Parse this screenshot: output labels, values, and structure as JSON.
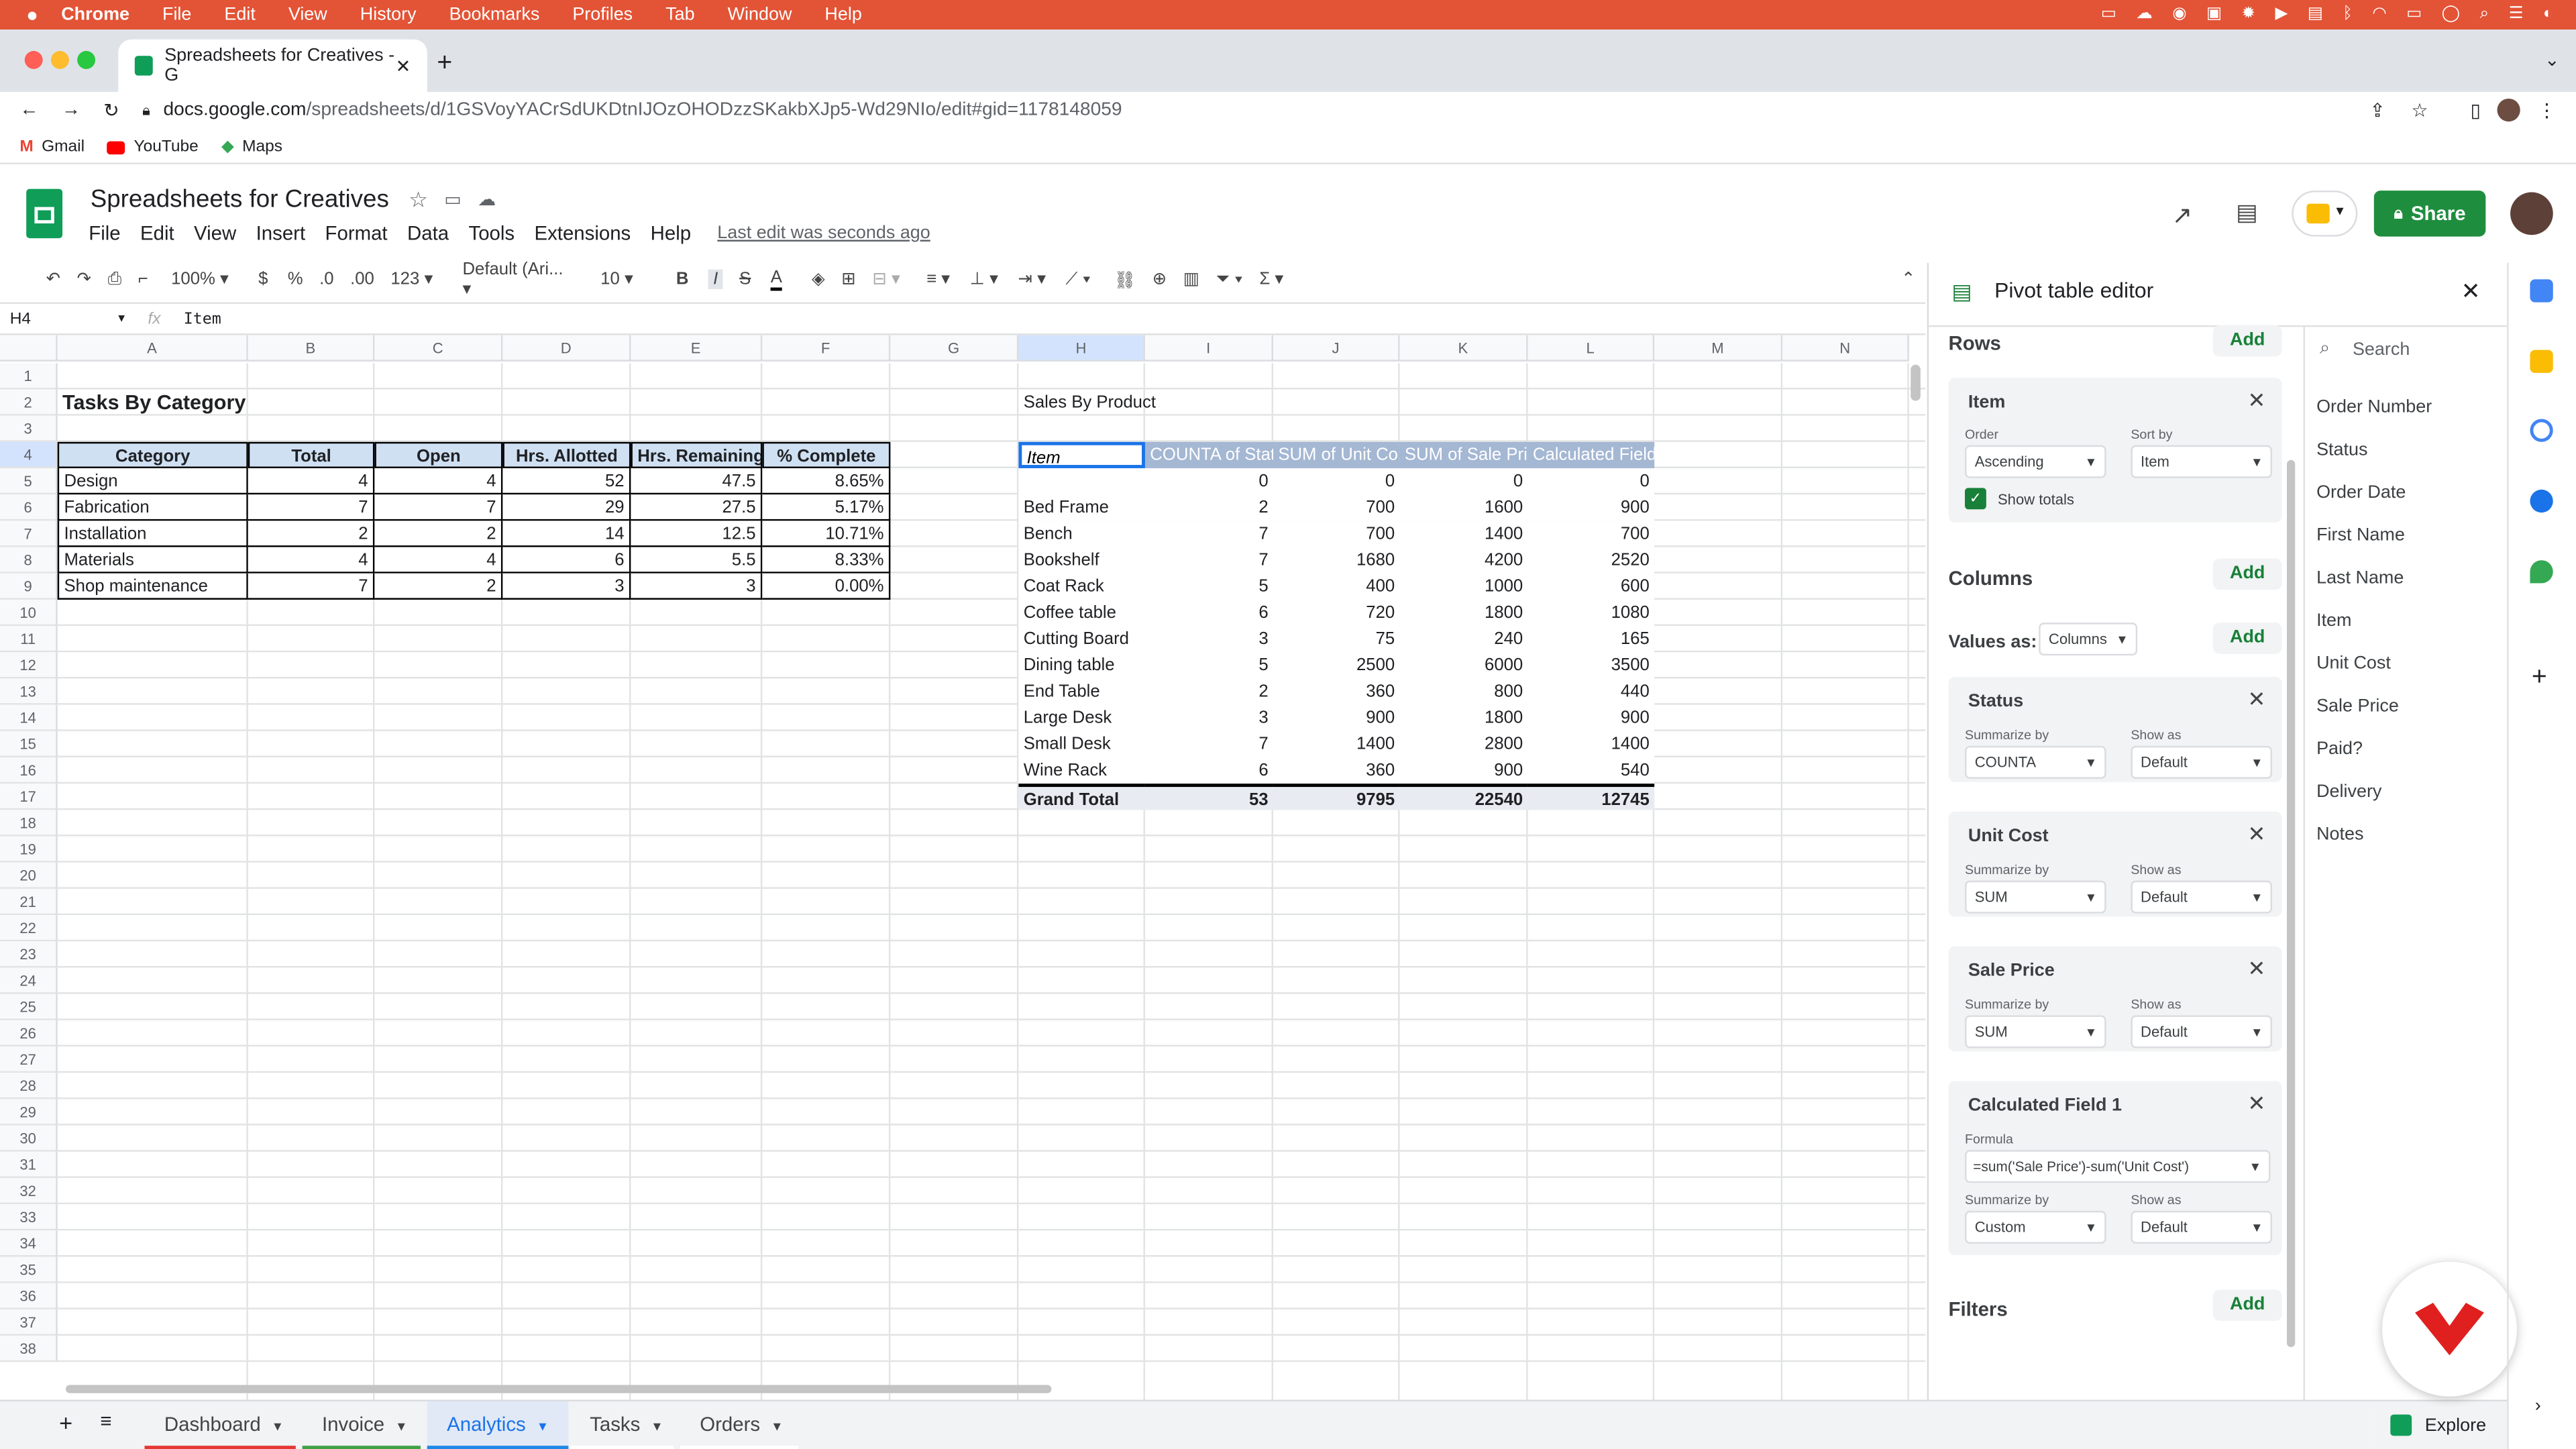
{
  "menubar": {
    "apple": "",
    "items": [
      "Chrome",
      "File",
      "Edit",
      "View",
      "History",
      "Bookmarks",
      "Profiles",
      "Tab",
      "Window",
      "Help"
    ]
  },
  "browser": {
    "tab_title": "Spreadsheets for Creatives - G",
    "url_host": "docs.google.com",
    "url_path": "/spreadsheets/d/1GSVoyYACrSdUKDtnIJOzOHODzzSKakbXJp5-Wd29NIo/edit#gid=1178148059",
    "bookmarks": [
      "Gmail",
      "YouTube",
      "Maps"
    ]
  },
  "doc": {
    "title": "Spreadsheets for Creatives",
    "menus": [
      "File",
      "Edit",
      "View",
      "Insert",
      "Format",
      "Data",
      "Tools",
      "Extensions",
      "Help"
    ],
    "last_edit": "Last edit was seconds ago",
    "share": "Share"
  },
  "toolbar": {
    "zoom": "100%",
    "currency": "$",
    "percent": "%",
    "dec_dec": ".0",
    "dec_inc": ".00",
    "numfmt": "123",
    "font": "Default (Ari...",
    "size": "10"
  },
  "formula_bar": {
    "cell_ref": "H4",
    "fx": "fx",
    "content": "Item"
  },
  "columns": [
    "A",
    "B",
    "C",
    "D",
    "E",
    "F",
    "G",
    "H",
    "I",
    "J",
    "K",
    "L",
    "M",
    "N"
  ],
  "rows": [
    "1",
    "2",
    "3",
    "4",
    "5",
    "6",
    "7",
    "8",
    "9",
    "10",
    "11",
    "12",
    "13",
    "14",
    "15",
    "16",
    "17",
    "18",
    "19",
    "20",
    "21",
    "22",
    "23",
    "24",
    "25",
    "26",
    "27",
    "28",
    "29",
    "30",
    "31",
    "32",
    "33",
    "34",
    "35",
    "36",
    "37",
    "38"
  ],
  "left_table": {
    "title": "Tasks By Category",
    "headers": [
      "Category",
      "Total",
      "Open",
      "Hrs. Allotted",
      "Hrs. Remaining",
      "% Complete"
    ],
    "rows": [
      [
        "Design",
        "4",
        "4",
        "52",
        "47.5",
        "8.65%"
      ],
      [
        "Fabrication",
        "7",
        "7",
        "29",
        "27.5",
        "5.17%"
      ],
      [
        "Installation",
        "2",
        "2",
        "14",
        "12.5",
        "10.71%"
      ],
      [
        "Materials",
        "4",
        "4",
        "6",
        "5.5",
        "8.33%"
      ],
      [
        "Shop maintenance",
        "7",
        "2",
        "3",
        "3",
        "0.00%"
      ]
    ]
  },
  "pivot": {
    "title": "Sales By Product",
    "headers": [
      "Item",
      "COUNTA of Stat",
      "SUM of Unit Co:",
      "SUM of Sale Pri",
      "Calculated Field"
    ],
    "rows": [
      [
        "",
        "0",
        "0",
        "0",
        "0"
      ],
      [
        "Bed Frame",
        "2",
        "700",
        "1600",
        "900"
      ],
      [
        "Bench",
        "7",
        "700",
        "1400",
        "700"
      ],
      [
        "Bookshelf",
        "7",
        "1680",
        "4200",
        "2520"
      ],
      [
        "Coat Rack",
        "5",
        "400",
        "1000",
        "600"
      ],
      [
        "Coffee table",
        "6",
        "720",
        "1800",
        "1080"
      ],
      [
        "Cutting Board",
        "3",
        "75",
        "240",
        "165"
      ],
      [
        "Dining table",
        "5",
        "2500",
        "6000",
        "3500"
      ],
      [
        "End Table",
        "2",
        "360",
        "800",
        "440"
      ],
      [
        "Large Desk",
        "3",
        "900",
        "1800",
        "900"
      ],
      [
        "Small Desk",
        "7",
        "1400",
        "2800",
        "1400"
      ],
      [
        "Wine Rack",
        "6",
        "360",
        "900",
        "540"
      ]
    ],
    "total": [
      "Grand Total",
      "53",
      "9795",
      "22540",
      "12745"
    ]
  },
  "sheet_tabs": [
    "Dashboard",
    "Invoice",
    "Analytics",
    "Tasks",
    "Orders"
  ],
  "sheet_tab_colors": [
    "#e53935",
    "#43a047",
    "#1e88e5",
    "#ffffff",
    "#ffffff"
  ],
  "panel": {
    "title": "Pivot table editor",
    "rows_label": "Rows",
    "columns_label": "Columns",
    "values_label": "Values as:",
    "values_mode": "Columns",
    "filters_label": "Filters",
    "add": "Add",
    "row_card": {
      "title": "Item",
      "order_label": "Order",
      "order": "Ascending",
      "sortby_label": "Sort by",
      "sortby": "Item",
      "show_totals": "Show totals"
    },
    "value_cards": [
      {
        "title": "Status",
        "summ_label": "Summarize by",
        "summ": "COUNTA",
        "show_label": "Show as",
        "show": "Default"
      },
      {
        "title": "Unit Cost",
        "summ_label": "Summarize by",
        "summ": "SUM",
        "show_label": "Show as",
        "show": "Default"
      },
      {
        "title": "Sale Price",
        "summ_label": "Summarize by",
        "summ": "SUM",
        "show_label": "Show as",
        "show": "Default"
      }
    ],
    "calc_card": {
      "title": "Calculated Field 1",
      "formula_label": "Formula",
      "formula": "=sum('Sale Price')-sum('Unit Cost')",
      "summ_label": "Summarize by",
      "summ": "Custom",
      "show_label": "Show as",
      "show": "Default"
    },
    "search_placeholder": "Search",
    "fields": [
      "Order Number",
      "Status",
      "Order Date",
      "First Name",
      "Last Name",
      "Item",
      "Unit Cost",
      "Sale Price",
      "Paid?",
      "Delivery",
      "Notes"
    ]
  },
  "explore": "Explore",
  "colors": {
    "menubar": "#e35336",
    "share": "#1e8e3e",
    "pivot_header": "#a4b7d3",
    "table_header": "#cfe0f3"
  }
}
